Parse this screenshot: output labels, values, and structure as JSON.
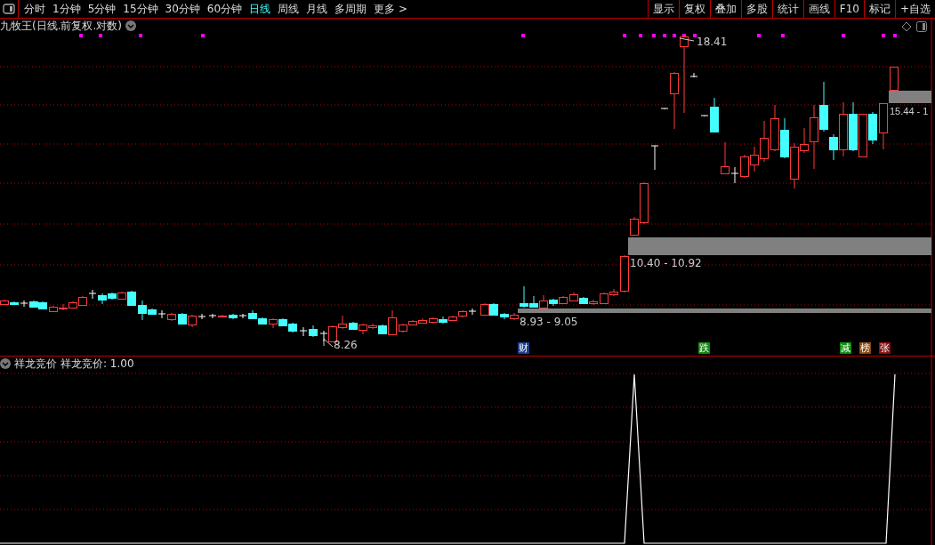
{
  "toolbar": {
    "periods": [
      {
        "label": "分时",
        "selected": false
      },
      {
        "label": "1分钟",
        "selected": false
      },
      {
        "label": "5分钟",
        "selected": false
      },
      {
        "label": "15分钟",
        "selected": false
      },
      {
        "label": "30分钟",
        "selected": false
      },
      {
        "label": "60分钟",
        "selected": false
      },
      {
        "label": "日线",
        "selected": true
      },
      {
        "label": "周线",
        "selected": false
      },
      {
        "label": "月线",
        "selected": false
      },
      {
        "label": "多周期",
        "selected": false
      },
      {
        "label": "更多 >",
        "selected": false
      }
    ],
    "buttons": [
      "显示",
      "复权",
      "叠加",
      "多股",
      "统计",
      "画线",
      "F10",
      "标记",
      "+自选"
    ]
  },
  "main_chart": {
    "title": "九牧王(日线.前复权.对数)",
    "labels": [
      {
        "kind": "high",
        "text": "18.41"
      },
      {
        "kind": "low",
        "text": "8.26"
      },
      {
        "kind": "band",
        "text": "10.40 - 10.92"
      },
      {
        "kind": "band",
        "text": "8.93 - 9.05"
      },
      {
        "kind": "band",
        "text": "15.44 - 1"
      }
    ],
    "events": [
      {
        "text": "财",
        "color": "#1a3f8a"
      },
      {
        "text": "跌",
        "color": "#108a10"
      },
      {
        "text": "减",
        "color": "#108a10"
      },
      {
        "text": "榜",
        "color": "#8a4a10"
      },
      {
        "text": "张",
        "color": "#8a1010"
      }
    ]
  },
  "indicator": {
    "name": "祥龙竞价",
    "reading": "祥龙竞价: 1.00"
  }
}
